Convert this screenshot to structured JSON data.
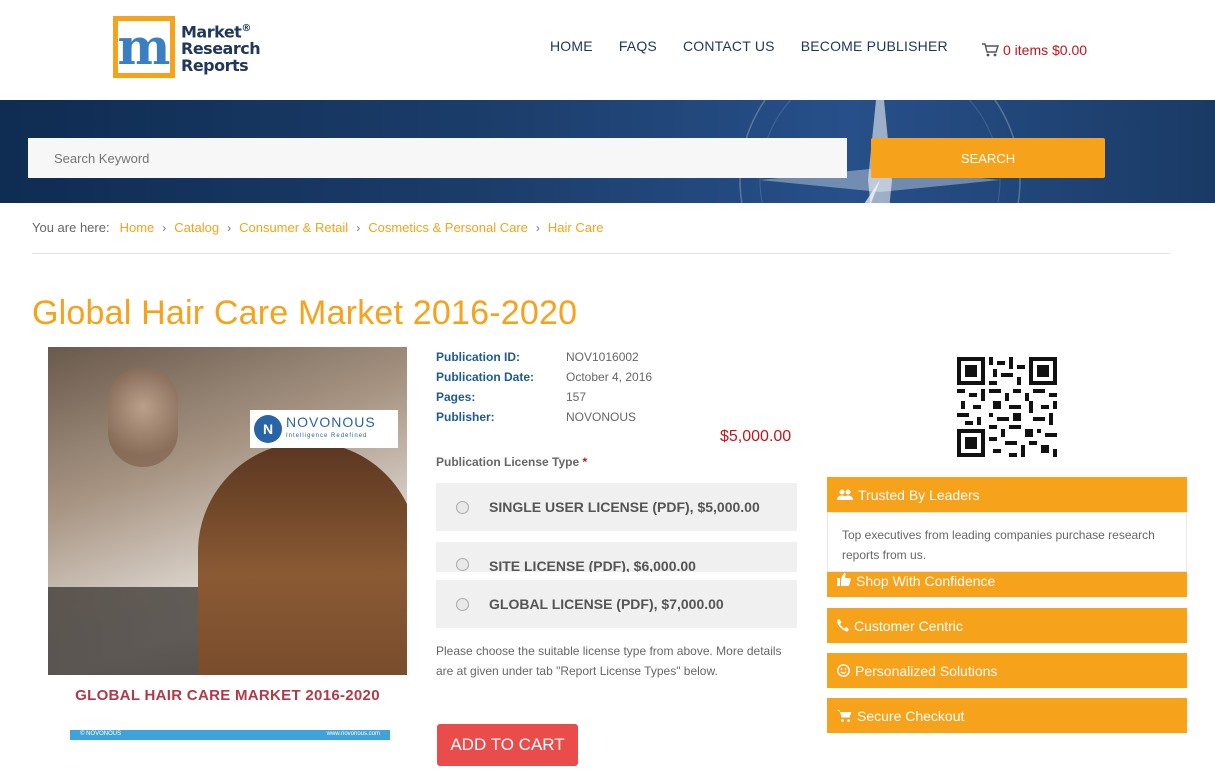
{
  "header": {
    "logo_lines": [
      "Market",
      "Research",
      "Reports"
    ],
    "logo_symbol": "®",
    "nav": [
      "HOME",
      "FAQS",
      "CONTACT US",
      "BECOME PUBLISHER"
    ],
    "cart_label": "0 items $0.00"
  },
  "search": {
    "placeholder": "Search Keyword",
    "button_label": "SEARCH"
  },
  "breadcrumb": {
    "prefix": "You are here:",
    "items": [
      "Home",
      "Catalog",
      "Consumer & Retail",
      "Cosmetics & Personal Care",
      "Hair Care"
    ]
  },
  "product": {
    "title": "Global Hair Care Market 2016-2020",
    "cover": {
      "brand": "NOVONOUS",
      "tagline": "Intelligence Redefined",
      "band_title": "GLOBAL HAIR CARE MARKET 2016-2020",
      "band_left": "© NOVONOUS",
      "band_right": "www.novonous.com"
    },
    "meta": [
      {
        "label": "Publication ID:",
        "value": "NOV1016002"
      },
      {
        "label": "Publication Date:",
        "value": "October 4, 2016"
      },
      {
        "label": "Pages:",
        "value": "157"
      },
      {
        "label": "Publisher:",
        "value": "NOVONOUS"
      }
    ],
    "price": "$5,000.00",
    "license_label": "Publication License Type",
    "required_mark": "*",
    "licenses": [
      "SINGLE USER LICENSE (PDF), $5,000.00",
      "SITE LICENSE (PDF), $6,000.00",
      "GLOBAL LICENSE (PDF), $7,000.00"
    ],
    "note": "Please choose the suitable license type from above. More details are at given under tab \"Report License Types\" below.",
    "add_to_cart": "ADD TO CART"
  },
  "sidebar": {
    "features": [
      {
        "label": "Trusted By Leaders",
        "icon": "users-icon"
      },
      {
        "label": "Shop With Confidence",
        "icon": "thumbs-up-icon"
      },
      {
        "label": "Customer Centric",
        "icon": "phone-icon"
      },
      {
        "label": "Personalized Solutions",
        "icon": "smile-icon"
      },
      {
        "label": "Secure Checkout",
        "icon": "cart-icon"
      }
    ],
    "trusted_desc": "Top executives from leading companies purchase research reports from us."
  },
  "colors": {
    "accent": "#f7a21b",
    "navy": "#1f3759",
    "price_red": "#c4141b",
    "cart_button": "#ea4c4c"
  }
}
